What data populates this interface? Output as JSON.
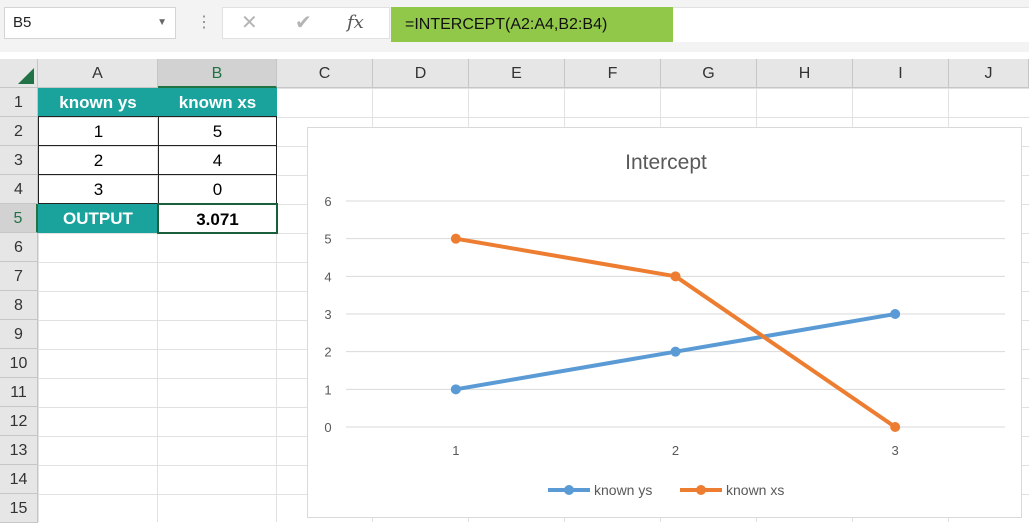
{
  "name_box": "B5",
  "formula": "=INTERCEPT(A2:A4,B2:B4)",
  "columns": [
    "A",
    "B",
    "C",
    "D",
    "E",
    "F",
    "G",
    "H",
    "I",
    "J"
  ],
  "rows": [
    "1",
    "2",
    "3",
    "4",
    "5",
    "6",
    "7",
    "8",
    "9",
    "10",
    "11",
    "12",
    "13",
    "14",
    "15"
  ],
  "cells": {
    "a1": "known ys",
    "b1": "known xs",
    "a2": "1",
    "b2": "5",
    "a3": "2",
    "b3": "4",
    "a4": "3",
    "b4": "0",
    "a5": "OUTPUT",
    "b5": "3.071"
  },
  "colors": {
    "header_teal": "#1aa39c",
    "formula_green": "#92c84a",
    "excel_green": "#217346"
  },
  "chart_data": {
    "type": "line",
    "title": "Intercept",
    "categories": [
      "1",
      "2",
      "3"
    ],
    "series": [
      {
        "name": "known ys",
        "values": [
          1,
          2,
          3
        ],
        "color": "#5b9bd5"
      },
      {
        "name": "known xs",
        "values": [
          5,
          4,
          0
        ],
        "color": "#ed7d31"
      }
    ],
    "ylim": [
      0,
      6
    ],
    "yticks": [
      0,
      1,
      2,
      3,
      4,
      5,
      6
    ],
    "grid": true,
    "legend": "bottom"
  }
}
